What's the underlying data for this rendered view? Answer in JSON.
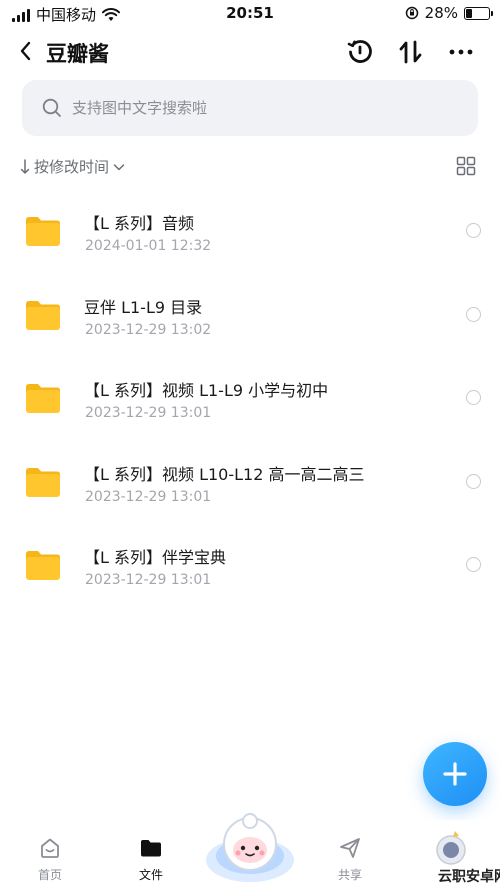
{
  "status_bar": {
    "carrier": "中国移动",
    "time": "20:51",
    "battery": "28%",
    "battery_level": 0.28
  },
  "header": {
    "title": "豆瓣酱",
    "icons": [
      "back-icon",
      "history-icon",
      "sort-icon",
      "more-icon"
    ]
  },
  "search": {
    "placeholder": "支持图中文字搜索啦"
  },
  "sort": {
    "label": "按修改时间"
  },
  "files": [
    {
      "name": "【L 系列】音频",
      "date": "2024-01-01 12:32"
    },
    {
      "name": "豆伴 L1-L9 目录",
      "date": "2023-12-29 13:02"
    },
    {
      "name": "【L 系列】视频 L1-L9 小学与初中",
      "date": "2023-12-29 13:01"
    },
    {
      "name": "【L 系列】视频 L10-L12 高一高二高三",
      "date": "2023-12-29 13:01"
    },
    {
      "name": "【L 系列】伴学宝典",
      "date": "2023-12-29 13:01"
    }
  ],
  "tabs": {
    "home": "首页",
    "files": "文件",
    "share": "共享"
  },
  "watermark": {
    "text": "云职安卓网"
  },
  "colors": {
    "accent": "#1e8ff5",
    "folder": "#ffc62e",
    "search_bg": "#f1f2f6"
  }
}
